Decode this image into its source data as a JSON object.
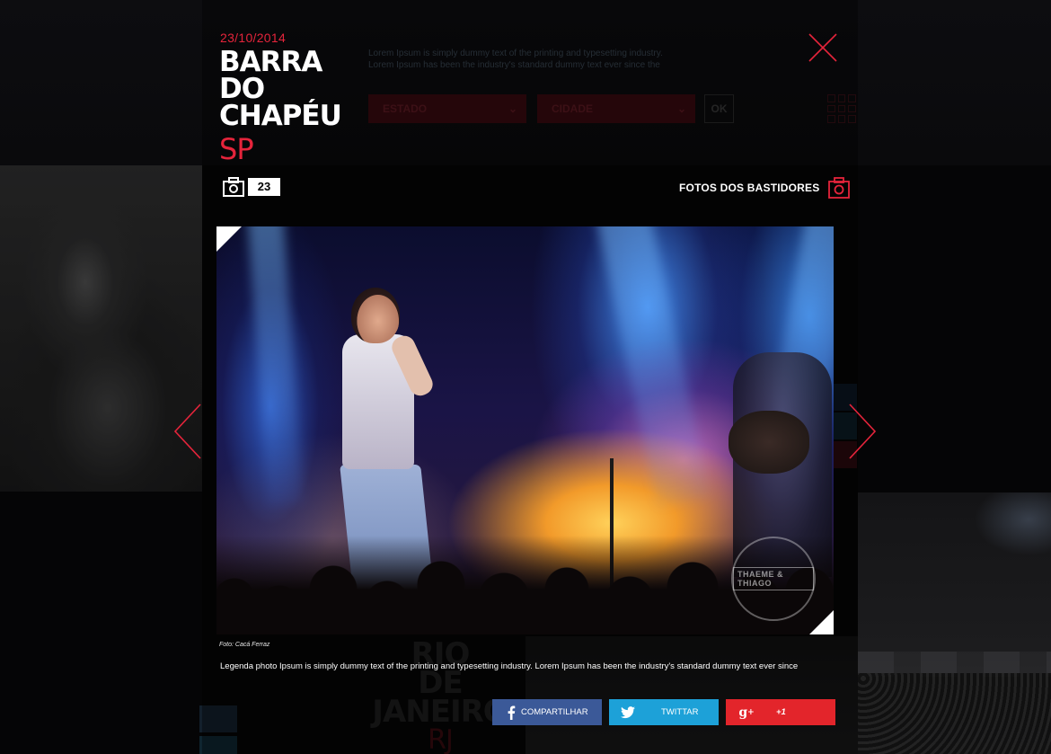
{
  "event": {
    "date": "23/10/2014",
    "title_lines": [
      "BARRA",
      "DO",
      "CHAPÉU"
    ],
    "state": "SP"
  },
  "gallery": {
    "photo_count": "23",
    "backstage_label": "FOTOS DOS BASTIDORES",
    "photo_credit": "Foto: Cacá Ferraz",
    "caption": "Legenda photo  Ipsum is simply dummy text of the printing and typesetting industry. Lorem Ipsum has been the industry's standard dummy text ever since",
    "watermark_text": "THAEME & THIAGO"
  },
  "share": {
    "facebook_label": "COMPARTILHAR",
    "twitter_label": "TWITTAR",
    "gplus_label": "+1",
    "colors": {
      "facebook": "#3b5998",
      "twitter": "#1da1d8",
      "gplus": "#e3252b"
    }
  },
  "background_page": {
    "intro_lines": [
      "Lorem Ipsum is simply dummy text of the printing and typesetting industry.",
      "Lorem Ipsum has been the industry's standard dummy text ever since the"
    ],
    "filter_state_placeholder": "ESTADO",
    "filter_city_placeholder": "CIDADE",
    "ok_label": "OK",
    "city_lines": [
      "RIO",
      "DE",
      "JANEIRO"
    ],
    "city_state": "RJ"
  },
  "icons": {
    "close": "close-icon",
    "camera": "camera-icon",
    "prev": "chevron-left-icon",
    "next": "chevron-right-icon",
    "facebook": "facebook-icon",
    "twitter": "twitter-icon",
    "gplus": "google-plus-icon"
  },
  "theme": {
    "accent": "#e5243b",
    "background": "#000000",
    "text": "#ffffff"
  }
}
